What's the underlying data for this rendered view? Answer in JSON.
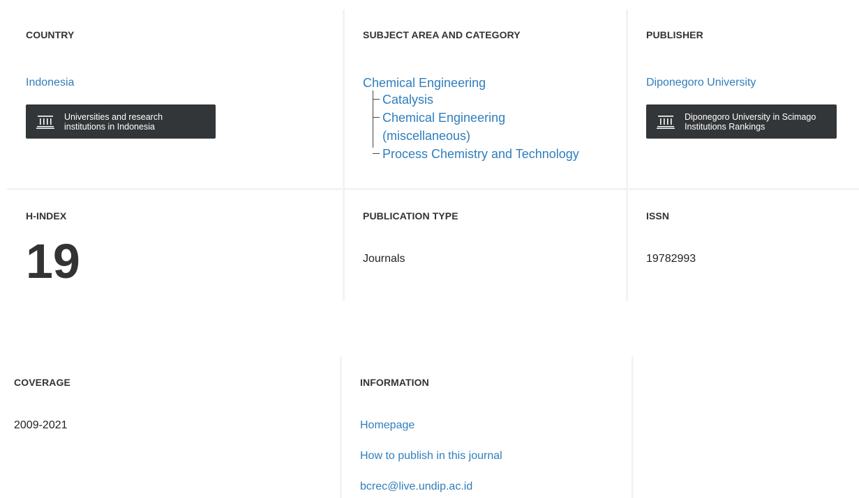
{
  "country": {
    "heading": "COUNTRY",
    "value": "Indonesia",
    "button_label": "Universities and research institutions in Indonesia",
    "button_line1": "Universities and research",
    "button_line2": "institutions in Indonesia",
    "button_icon": "institution-icon"
  },
  "subject": {
    "heading": "SUBJECT AREA AND CATEGORY",
    "area": "Chemical Engineering",
    "categories": [
      "Catalysis",
      "Chemical Engineering",
      "(miscellaneous)",
      "Process Chemistry and Technology"
    ]
  },
  "publisher": {
    "heading": "PUBLISHER",
    "value": "Diponegoro University",
    "button_line1": "Diponegoro University in Scimago",
    "button_line2": "Institutions Rankings",
    "button_icon": "institution-icon"
  },
  "hindex": {
    "heading": "H-INDEX",
    "value": "19"
  },
  "pubtype": {
    "heading": "PUBLICATION TYPE",
    "value": "Journals"
  },
  "issn": {
    "heading": "ISSN",
    "value": "19782993"
  },
  "coverage": {
    "heading": "COVERAGE",
    "value": "2009-2021"
  },
  "information": {
    "heading": "INFORMATION",
    "links": [
      "Homepage",
      "How to publish in this journal",
      "bcrec@live.undip.ac.id"
    ]
  },
  "colors": {
    "link": "#2f7ebc",
    "button_bg": "#333638",
    "separator": "#f3f3f3",
    "text": "#333333"
  }
}
